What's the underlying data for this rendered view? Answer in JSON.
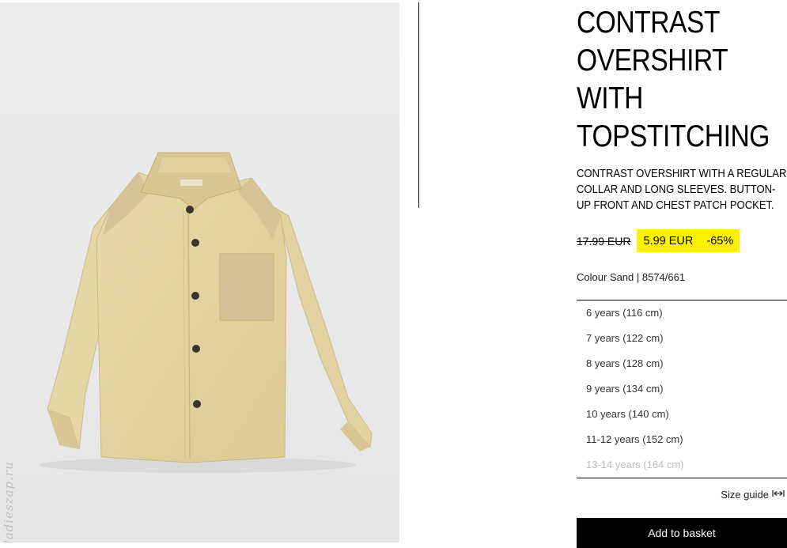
{
  "product": {
    "title_lines": [
      "CONTRAST",
      "OVERSHIRT",
      "WITH",
      "TOPSTITCHING"
    ],
    "description": "CONTRAST OVERSHIRT WITH A REGULAR COLLAR AND LONG SLEEVES. BUTTON-UP FRONT AND CHEST PATCH POCKET.",
    "old_price": "17.99 EUR",
    "new_price": "5.99 EUR",
    "discount": "-65%",
    "colour_line": "Colour Sand | 8574/661",
    "image_watermark": "ladieszap.ru"
  },
  "sizes": [
    {
      "label": "6 years (116 cm)",
      "available": true
    },
    {
      "label": "7 years (122 cm)",
      "available": true
    },
    {
      "label": "8 years (128 cm)",
      "available": true
    },
    {
      "label": "9 years (134 cm)",
      "available": true
    },
    {
      "label": "10 years (140 cm)",
      "available": true
    },
    {
      "label": "11-12 years (152 cm)",
      "available": true
    },
    {
      "label": "13-14 years (164 cm)",
      "available": false
    }
  ],
  "size_guide_label": "Size guide",
  "add_to_basket_label": "Add to basket",
  "colors": {
    "sale_highlight": "#fff100",
    "shirt_body": "#e3d3a3",
    "shirt_contrast": "#d4c296",
    "buttons": "#3a342c",
    "unavailable_text": "#bdbdbd"
  },
  "icons": {
    "size_guide": "ruler-arrows-icon"
  }
}
